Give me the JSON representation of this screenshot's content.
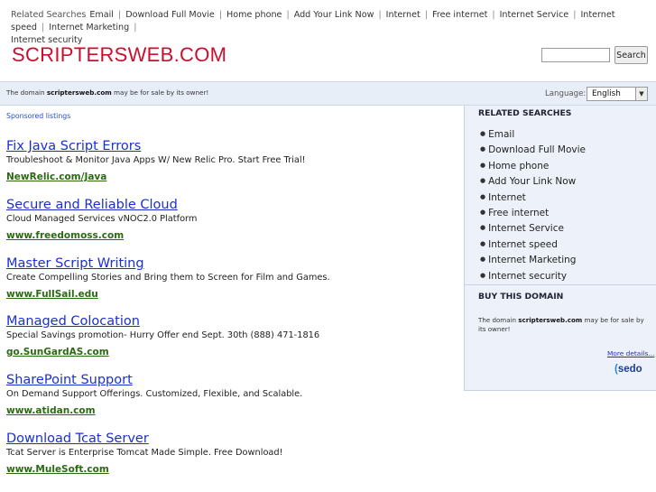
{
  "top_related": {
    "label": "Related Searches",
    "items": [
      "Email",
      "Download Full Movie",
      "Home phone",
      "Add Your Link Now",
      "Internet",
      "Free internet",
      "Internet Service",
      "Internet speed",
      "Internet Marketing",
      "Internet security"
    ]
  },
  "header": {
    "logo": "SCRIPTERSWEB.COM",
    "search_placeholder": "",
    "search_button": "Search"
  },
  "info_bar": {
    "sale_prefix": "The domain ",
    "sale_domain": "scriptersweb.com",
    "sale_suffix": " may be for sale by its owner!",
    "language_label": "Language:",
    "language_value": "English"
  },
  "main": {
    "sponsored_label": "Sponsored listings",
    "listings": [
      {
        "title": "Fix Java Script Errors",
        "desc": "Troubleshoot & Monitor Java Apps W/ New Relic Pro. Start Free Trial!",
        "url": "NewRelic.com/Java"
      },
      {
        "title": "Secure and Reliable Cloud",
        "desc": "Cloud Managed Services vNOC2.0 Platform",
        "url": "www.freedomoss.com"
      },
      {
        "title": "Master Script Writing",
        "desc": "Create Compelling Stories and Bring them to Screen for Film and Games.",
        "url": "www.FullSail.edu"
      },
      {
        "title": "Managed Colocation",
        "desc": "Special Savings promotion- Hurry Offer end Sept. 30th (888) 471-1816",
        "url": "go.SunGardAS.com"
      },
      {
        "title": "SharePoint Support",
        "desc": "On Demand Support Offerings. Customized, Flexible, and Scalable.",
        "url": "www.atidan.com"
      },
      {
        "title": "Download Tcat Server",
        "desc": "Tcat Server is Enterprise Tomcat Made Simple. Free Download!",
        "url": "www.MuleSoft.com"
      }
    ]
  },
  "sidebar": {
    "related_heading": "RELATED SEARCHES",
    "related_items": [
      "Email",
      "Download Full Movie",
      "Home phone",
      "Add Your Link Now",
      "Internet",
      "Free internet",
      "Internet Service",
      "Internet speed",
      "Internet Marketing",
      "Internet security"
    ],
    "buy_heading": "BUY THIS DOMAIN",
    "buy_prefix": "The domain ",
    "buy_domain": "scriptersweb.com",
    "buy_suffix": " may be for sale by its owner!",
    "more_details": "More details...",
    "sedo_logo": "sedo"
  },
  "colors": {
    "logo": "#c8102e",
    "link": "#1a2fd4",
    "url": "#2b6a12",
    "panel_bg": "#edf2fa"
  }
}
